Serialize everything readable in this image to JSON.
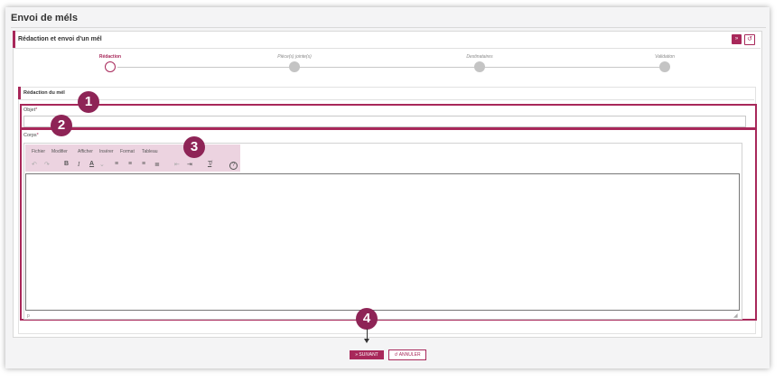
{
  "page": {
    "title": "Envoi de méls"
  },
  "card": {
    "title": "Rédaction et envoi d'un mél",
    "btn_collapse": "»",
    "btn_reset": "↺"
  },
  "stepper": {
    "steps": [
      {
        "label": "Rédaction",
        "active": true
      },
      {
        "label": "Pièce(s) jointe(s)",
        "active": false
      },
      {
        "label": "Destinataires",
        "active": false
      },
      {
        "label": "Validation",
        "active": false
      }
    ]
  },
  "section": {
    "title": "Rédaction du mél"
  },
  "objet": {
    "label": "Objet",
    "required_mark": "*",
    "value": ""
  },
  "corps": {
    "label": "Corps",
    "required_mark": "*"
  },
  "editor": {
    "menu": [
      "Fichier",
      "Modifier",
      "Afficher",
      "Insérer",
      "Format",
      "Tableau"
    ],
    "tools": [
      {
        "name": "undo-icon",
        "glyph": "↶",
        "disabled": true
      },
      {
        "name": "redo-icon",
        "glyph": "↷",
        "disabled": true
      },
      {
        "name": "bold-icon",
        "glyph": "B",
        "disabled": false
      },
      {
        "name": "italic-icon",
        "glyph": "I",
        "disabled": false
      },
      {
        "name": "text-color-icon",
        "glyph": "A",
        "disabled": false
      },
      {
        "name": "text-color-dropdown-icon",
        "glyph": "⌄",
        "disabled": true
      },
      {
        "name": "align-left-icon",
        "glyph": "≡",
        "disabled": false
      },
      {
        "name": "align-center-icon",
        "glyph": "≡",
        "disabled": false
      },
      {
        "name": "align-right-icon",
        "glyph": "≡",
        "disabled": false
      },
      {
        "name": "align-justify-icon",
        "glyph": "≣",
        "disabled": false
      },
      {
        "name": "outdent-icon",
        "glyph": "⇤",
        "disabled": true
      },
      {
        "name": "indent-icon",
        "glyph": "⇥",
        "disabled": false
      },
      {
        "name": "clear-format-icon",
        "glyph": "T̸",
        "disabled": false
      },
      {
        "name": "help-icon",
        "glyph": "?",
        "disabled": false
      }
    ],
    "status": "p",
    "content": ""
  },
  "annotations": [
    "1",
    "2",
    "3",
    "4"
  ],
  "actions": {
    "next_label": "» SUIVANT",
    "cancel_label": "↺ ANNULER"
  },
  "colors": {
    "accent": "#a8285a",
    "badge": "#8e2456",
    "toolbar_highlight": "#ecd3e0"
  }
}
